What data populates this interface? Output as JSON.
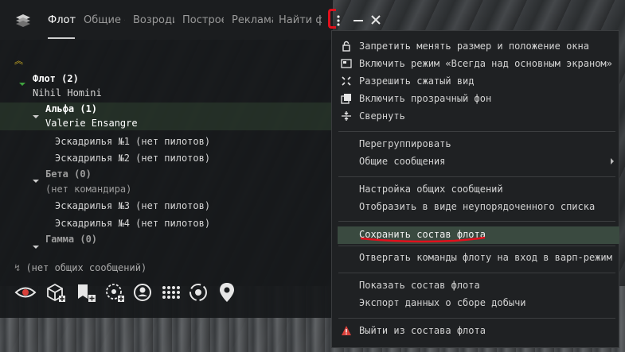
{
  "fleet_window": {
    "tabs": [
      "Флот",
      "Общие с",
      "Возроди",
      "Построе",
      "Реклама",
      "Найти ф"
    ],
    "active_tab": "Флот",
    "tree": {
      "fleet_label": "Флот (2)",
      "fleet_commander": "Nihil Homini",
      "wing_alpha": "Альфа (1)",
      "wing_alpha_commander": "Valerie Ensangre",
      "squad1": "Эскадрилья №1 (нет пилотов)",
      "squad2": "Эскадрилья №2 (нет пилотов)",
      "wing_beta": "Бета (0)",
      "wing_beta_commander": "(нет командира)",
      "squad3": "Эскадрилья №3 (нет пилотов)",
      "squad4": "Эскадрилья №4 (нет пилотов)",
      "wing_gamma": "Гамма (0)"
    },
    "motd": "(нет общих сообщений)",
    "toolbar_icons": [
      "watchlist-eye-icon",
      "fleet-broadcast-icon",
      "add-wing-icon",
      "target-icon",
      "fleet-member-icon",
      "grid-icon",
      "fleet-location-icon",
      "map-pin-icon"
    ]
  },
  "context_menu": {
    "items": [
      {
        "label": "Запретить менять размер и положение окна",
        "icon": "lock-icon"
      },
      {
        "label": "Включить режим «Всегда над основным экраном»",
        "icon": "always-on-top-icon"
      },
      {
        "label": "Разрешить сжатый вид",
        "icon": "compact-view-icon"
      },
      {
        "label": "Включить прозрачный фон",
        "icon": "transparent-bg-icon"
      },
      {
        "label": "Свернуть",
        "icon": "collapse-icon"
      },
      {
        "label": "Перегруппировать"
      },
      {
        "label": "Общие сообщения"
      },
      {
        "label": "Настройка общих сообщений"
      },
      {
        "label": "Отобразить в виде неупорядоченного списка"
      },
      {
        "label": "Сохранить состав флота"
      },
      {
        "label": "Отвергать команды флоту на вход в варп-режим"
      },
      {
        "label": "Показать состав флота"
      },
      {
        "label": "Экспорт данных о сборе добычи"
      },
      {
        "label": "Выйти из состава флота",
        "icon": "warning-icon"
      }
    ]
  },
  "colors": {
    "accent_red": "#e0101c",
    "warning_red": "#d9403a",
    "highlight": "#3a4a40"
  }
}
